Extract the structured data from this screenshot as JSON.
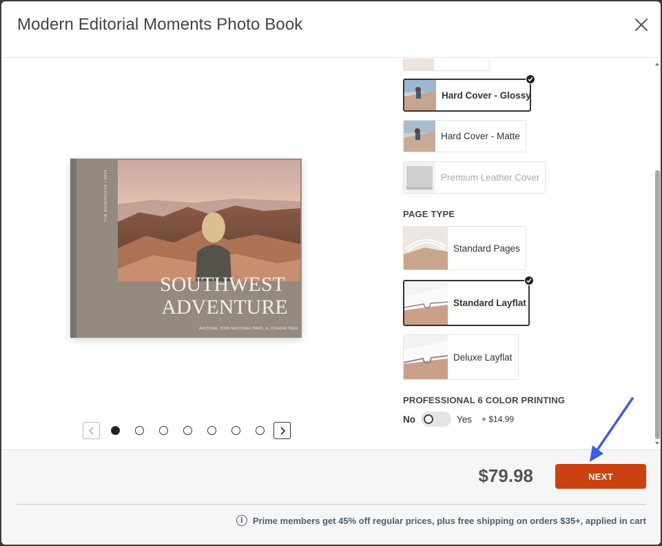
{
  "modal": {
    "title": "Modern Editorial Moments Photo Book"
  },
  "preview": {
    "spine_text": "THE ANDERSONS • 2024",
    "cover_title_line1": "SOUTHWEST",
    "cover_title_line2": "ADVENTURE",
    "cover_subtitle": "ARIZONA, ZION NATIONAL PARK, & JOSHUA TREE",
    "carousel_active_index": 0,
    "carousel_dot_count": 7
  },
  "cover_options": [
    {
      "label": "",
      "selected": false,
      "disabled": false
    },
    {
      "label": "Hard Cover - Glossy",
      "selected": true,
      "disabled": false
    },
    {
      "label": "Hard Cover - Matte",
      "selected": false,
      "disabled": false
    },
    {
      "label": "Premium Leather Cover",
      "selected": false,
      "disabled": true
    }
  ],
  "page_type": {
    "heading": "PAGE TYPE",
    "options": [
      {
        "label": "Standard Pages",
        "selected": false
      },
      {
        "label": "Standard Layflat",
        "selected": true
      },
      {
        "label": "Deluxe Layflat",
        "selected": false
      }
    ]
  },
  "printing": {
    "heading": "PROFESSIONAL 6 COLOR PRINTING",
    "no_label": "No",
    "yes_label": "Yes",
    "price": "+ $14.99",
    "enabled": false
  },
  "footer": {
    "price": "$79.98",
    "next_label": "NEXT",
    "promo_text": "Prime members get 45% off regular prices, plus free shipping on orders $35+, applied in cart"
  },
  "colors": {
    "accent": "#c9420f",
    "promo": "#4a5e77",
    "annotation_arrow": "#3b5be8"
  }
}
